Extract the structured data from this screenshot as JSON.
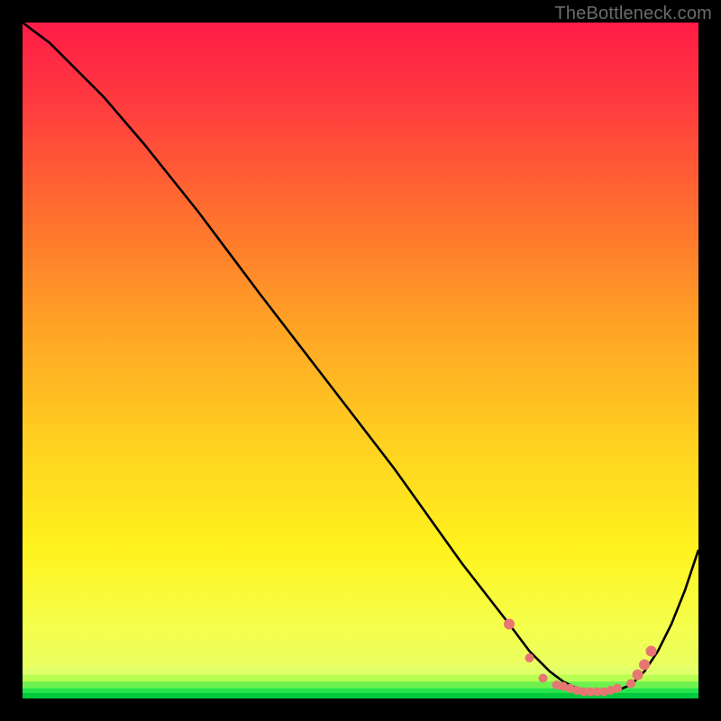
{
  "watermark": "TheBottleneck.com",
  "colors": {
    "curve_stroke": "#000000",
    "dot_fill": "#E77672",
    "green_band_top": "#DDFF66",
    "green_band_mid": "#24E34A",
    "green_band_bot": "#00C83C",
    "gradient_stops": [
      {
        "offset": 0.0,
        "color": "#FF1C47"
      },
      {
        "offset": 0.12,
        "color": "#FF3B3F"
      },
      {
        "offset": 0.28,
        "color": "#FF6E2F"
      },
      {
        "offset": 0.45,
        "color": "#FFA325"
      },
      {
        "offset": 0.62,
        "color": "#FFD020"
      },
      {
        "offset": 0.78,
        "color": "#FFF31E"
      },
      {
        "offset": 0.9,
        "color": "#F4FF4E"
      },
      {
        "offset": 1.0,
        "color": "#E0FF73"
      }
    ]
  },
  "chart_data": {
    "type": "line",
    "title": "",
    "xlabel": "",
    "ylabel": "",
    "xlim": [
      0,
      100
    ],
    "ylim": [
      0,
      100
    ],
    "series": [
      {
        "name": "curve",
        "x": [
          0,
          4,
          8,
          12,
          18,
          26,
          35,
          45,
          55,
          65,
          72,
          75,
          78,
          80,
          82,
          84,
          86,
          88,
          90,
          92,
          94,
          96,
          98,
          100
        ],
        "y": [
          100,
          97,
          93,
          89,
          82,
          72,
          60,
          47,
          34,
          20,
          11,
          7,
          4,
          2.5,
          1.5,
          1,
          1,
          1.2,
          2,
          4,
          7,
          11,
          16,
          22
        ]
      }
    ],
    "dots": {
      "name": "marked-points",
      "x": [
        72,
        75,
        77,
        79,
        80,
        81,
        82,
        83,
        84,
        85,
        86,
        87,
        88,
        90,
        91,
        92,
        93
      ],
      "y": [
        11,
        6,
        3,
        2,
        1.8,
        1.5,
        1.2,
        1.0,
        1.0,
        1.0,
        1.0,
        1.2,
        1.5,
        2.2,
        3.5,
        5,
        7
      ]
    }
  }
}
